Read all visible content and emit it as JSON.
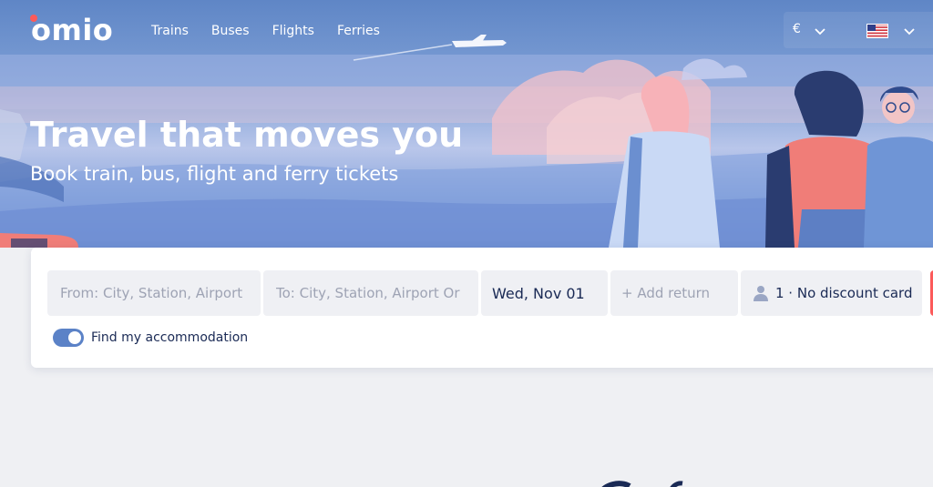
{
  "brand": {
    "logo_text": "omio",
    "accent_color": "#fc5a5a"
  },
  "nav": {
    "items": [
      "Trains",
      "Buses",
      "Flights",
      "Ferries"
    ]
  },
  "prefs": {
    "currency": "€",
    "country_flag": "us-flag-icon"
  },
  "hero": {
    "title": "Travel that moves you",
    "subtitle": "Book train, bus, flight and ferry tickets"
  },
  "search": {
    "from_placeholder": "From: City, Station, Airport",
    "to_placeholder": "To: City, Station, Airport Or",
    "date": "Wed, Nov 01",
    "return_label": "+ Add return",
    "passengers": "1 · No discount card",
    "accommodation_label": "Find my accommodation",
    "accommodation_on": true
  },
  "colors": {
    "hero_blue": "#6f8fd0",
    "field_bg": "#eff0f4",
    "text_dark": "#1a2a55",
    "toggle_blue": "#5b82c7"
  }
}
